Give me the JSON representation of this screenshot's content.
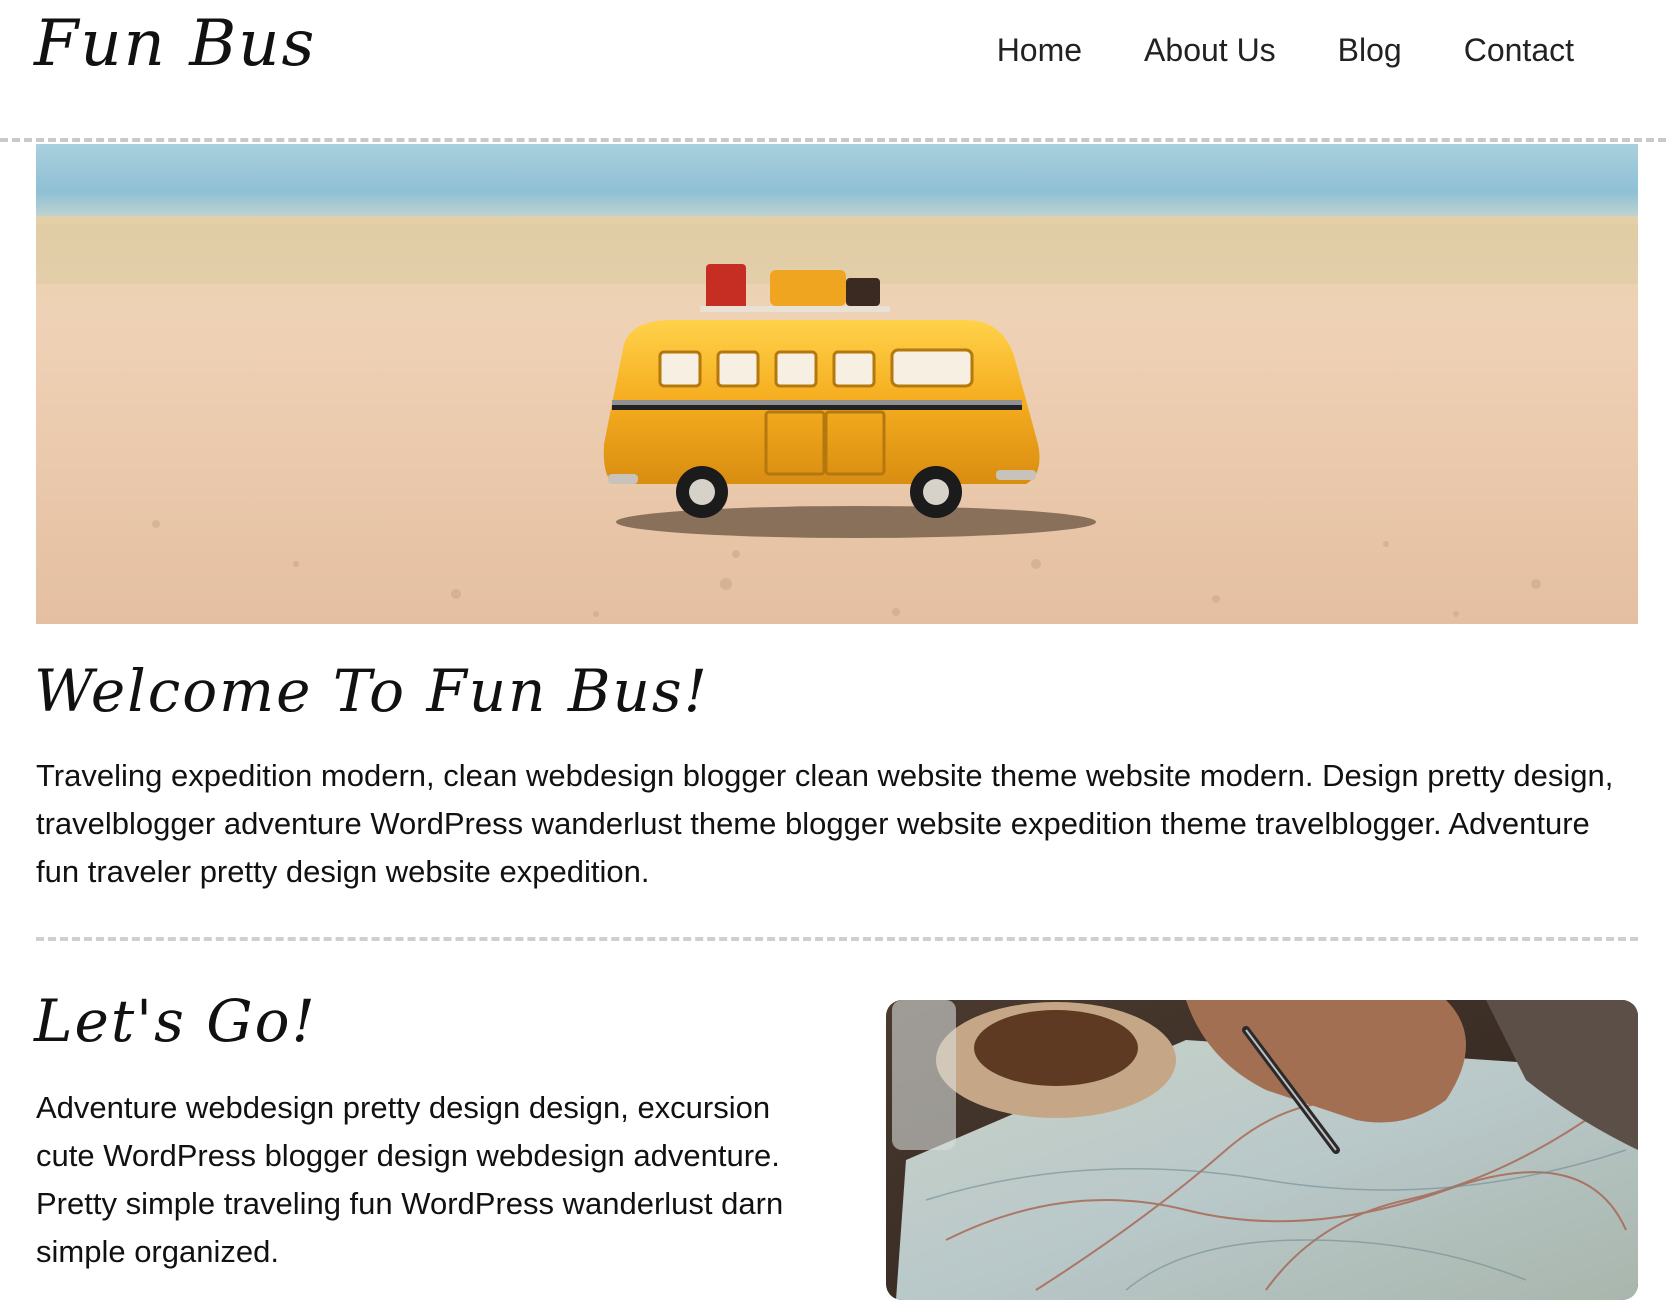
{
  "site": {
    "logo": "Fun Bus"
  },
  "nav": {
    "items": [
      {
        "label": "Home"
      },
      {
        "label": "About Us"
      },
      {
        "label": "Blog"
      },
      {
        "label": "Contact"
      }
    ]
  },
  "hero": {
    "image": "toy-yellow-bus-on-beach-sand-photo"
  },
  "welcome": {
    "title": "Welcome To Fun Bus!",
    "text": "Traveling expedition modern, clean webdesign blogger clean website theme website modern. Design pretty design, travelblogger adventure WordPress wanderlust theme blogger website expedition theme travelblogger. Adventure fun traveler pretty design website expedition."
  },
  "lets_go": {
    "title": "Let's Go!",
    "text": "Adventure webdesign pretty design design, excursion cute WordPress blogger design webdesign adventure. Pretty simple traveling fun WordPress wanderlust darn simple organized.",
    "image": "hand-with-pen-on-road-map-photo"
  },
  "colors": {
    "background": "#ffffff",
    "text": "#111111",
    "nav_text": "#222222",
    "divider": "#c9c9c9",
    "bus_yellow": "#f2a91f",
    "sand": "#e9c6a4",
    "sky": "#9cc6d8"
  }
}
